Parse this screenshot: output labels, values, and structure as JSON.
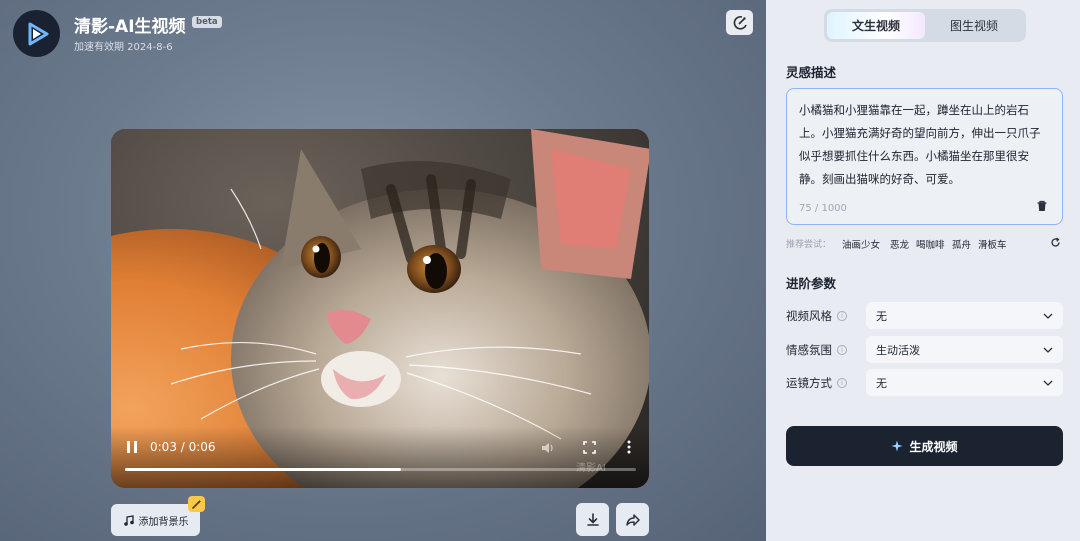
{
  "app": {
    "title": "清影-AI生视频",
    "badge": "beta",
    "subtitle": "加速有效期 2024-8-6"
  },
  "video": {
    "time": "0:03 / 0:06",
    "progress": 0.54,
    "watermark": "清影AI"
  },
  "actions": {
    "music_label": "添加背景乐"
  },
  "panel": {
    "tabs": [
      {
        "label": "文生视频",
        "active": true
      },
      {
        "label": "图生视频",
        "active": false
      }
    ],
    "prompt_title": "灵感描述",
    "prompt_text": "小橘猫和小狸猫靠在一起，蹲坐在山上的岩石上。小狸猫充满好奇的望向前方，伸出一只爪子似乎想要抓住什么东西。小橘猫坐在那里很安静。刻画出猫咪的好奇、可爱。",
    "counter": "75 / 1000",
    "suggest_label": "推荐尝试：",
    "suggestions": [
      "油画少女",
      "恶龙",
      "喝咖啡",
      "孤舟",
      "滑板车"
    ],
    "advanced_title": "进阶参数",
    "params": [
      {
        "label": "视频风格",
        "value": "无"
      },
      {
        "label": "情感氛围",
        "value": "生动活泼"
      },
      {
        "label": "运镜方式",
        "value": "无"
      }
    ],
    "generate_label": "生成视频"
  },
  "colors": {
    "accent": "#1b2230",
    "prompt_border": "#8fb3ff",
    "badge": "#f7c948"
  }
}
